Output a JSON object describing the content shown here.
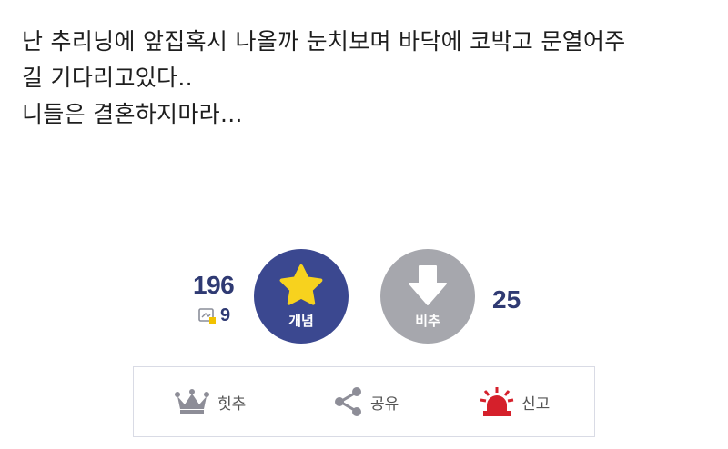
{
  "post": {
    "lines": [
      "난 추리닝에 앞집혹시 나올까 눈치보며 바닥에 코박고 문열어주",
      "길 기다리고있다..",
      "니들은 결혼하지마라..."
    ]
  },
  "vote": {
    "up_count": "196",
    "fixed_count": "9",
    "upvote_label": "개념",
    "down_count": "25",
    "downvote_label": "비추",
    "up_color": "#3b4890",
    "down_color": "#a6a7ad",
    "star_color": "#f7d21e"
  },
  "actions": {
    "hit_label": "힛추",
    "share_label": "공유",
    "report_label": "신고"
  },
  "icons": {
    "fixed": "fixed-post-icon",
    "star": "star-icon",
    "down_arrow": "down-arrow-icon",
    "crown": "crown-icon",
    "share": "share-icon",
    "siren": "siren-icon"
  }
}
